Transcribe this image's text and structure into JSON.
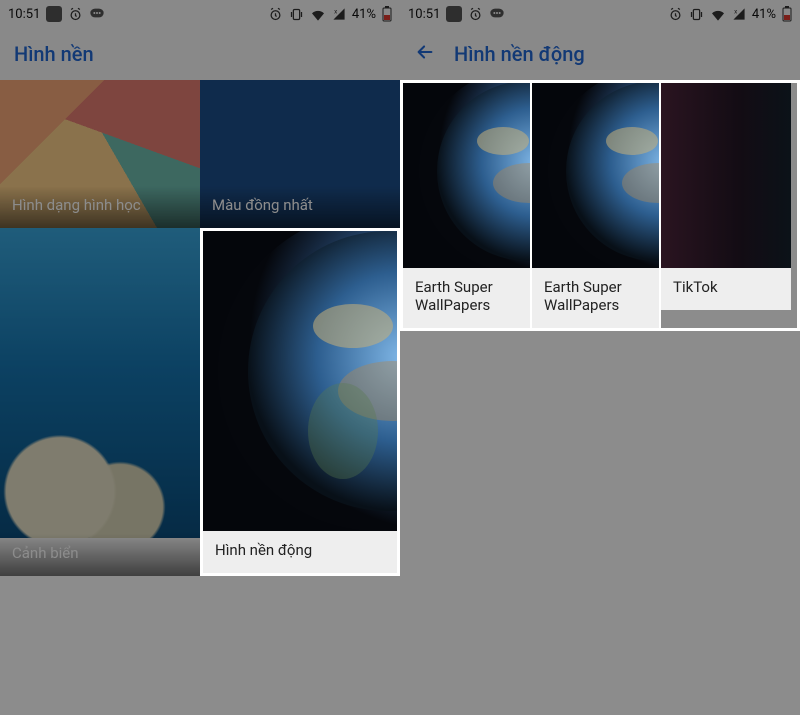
{
  "statusbar": {
    "time": "10:51",
    "battery_pct": "41%"
  },
  "left_screen": {
    "title": "Hình nền",
    "tiles": {
      "geometric": "Hình dạng hình học",
      "solid": "Màu đồng nhất",
      "sea": "Cảnh biển",
      "live": "Hình nền động"
    }
  },
  "right_screen": {
    "title": "Hình nền động",
    "tiles": {
      "earth1": "Earth Super WallPapers",
      "earth2": "Earth Super WallPapers",
      "tiktok": "TikTok"
    }
  }
}
